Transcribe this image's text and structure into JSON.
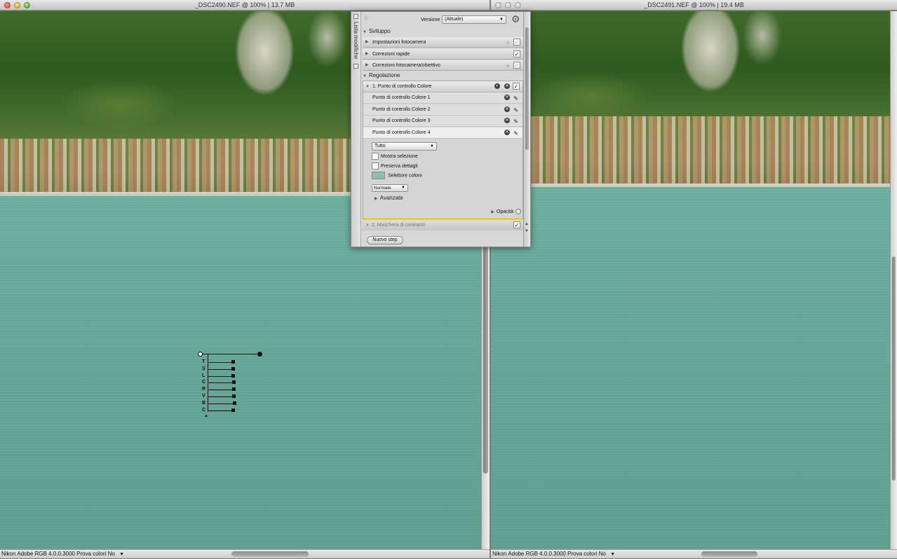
{
  "windows": {
    "left": {
      "title": "_DSC2490.NEF @ 100% | 13.7 MB",
      "status": "Nikon Adobe RGB 4.0.0.3000  Prova colori No"
    },
    "right": {
      "title": "_DSC2491.NEF @ 100% | 19.4 MB",
      "status": "Nikon Adobe RGB 4.0.0.3000  Prova colori No"
    }
  },
  "control_point": {
    "sliders": [
      {
        "label": "T",
        "value": 0.55
      },
      {
        "label": "S",
        "value": 0.55
      },
      {
        "label": "L",
        "value": 0.55
      },
      {
        "label": "C",
        "value": 0.57
      },
      {
        "label": "R",
        "value": 0.57
      },
      {
        "label": "V",
        "value": 0.57
      },
      {
        "label": "B",
        "value": 0.58
      },
      {
        "label": "C",
        "value": 0.55
      }
    ]
  },
  "panel": {
    "side_label": "Lista modifiche",
    "version_label": "Versione",
    "version_value": "(Attuale)",
    "sviluppo": {
      "title": "Sviluppo",
      "items": [
        {
          "label": "Impostazioni fotocamera",
          "checked": false,
          "linked": true
        },
        {
          "label": "Correzioni rapide",
          "checked": true,
          "linked": false
        },
        {
          "label": "Correzioni fotocamera/obiettivo",
          "checked": false,
          "linked": true
        }
      ]
    },
    "regolazione": {
      "title": "Regolazione",
      "step1": {
        "title": "1. Punto di controllo Colore",
        "points": [
          "Punto di controllo Colore 1",
          "Punto di controllo Colore 2",
          "Punto di controllo Colore 3",
          "Punto di controllo Colore 4"
        ],
        "scope": "Tutto",
        "mostra_selezione": "Mostra selezione",
        "preserva_dettagli": "Preserva dettagli",
        "selettore_colore": "Selettore colore",
        "swatch_color": "#8cc0ad",
        "blend_mode": "Normale",
        "avanzate": "Avanzate",
        "opacita": "Opacità"
      },
      "step2": {
        "title": "2. Maschera di contrasto"
      }
    },
    "new_step_button": "Nuovo step"
  },
  "colors": {
    "accent_outline": "#d2b400",
    "lake": "#66a898"
  }
}
